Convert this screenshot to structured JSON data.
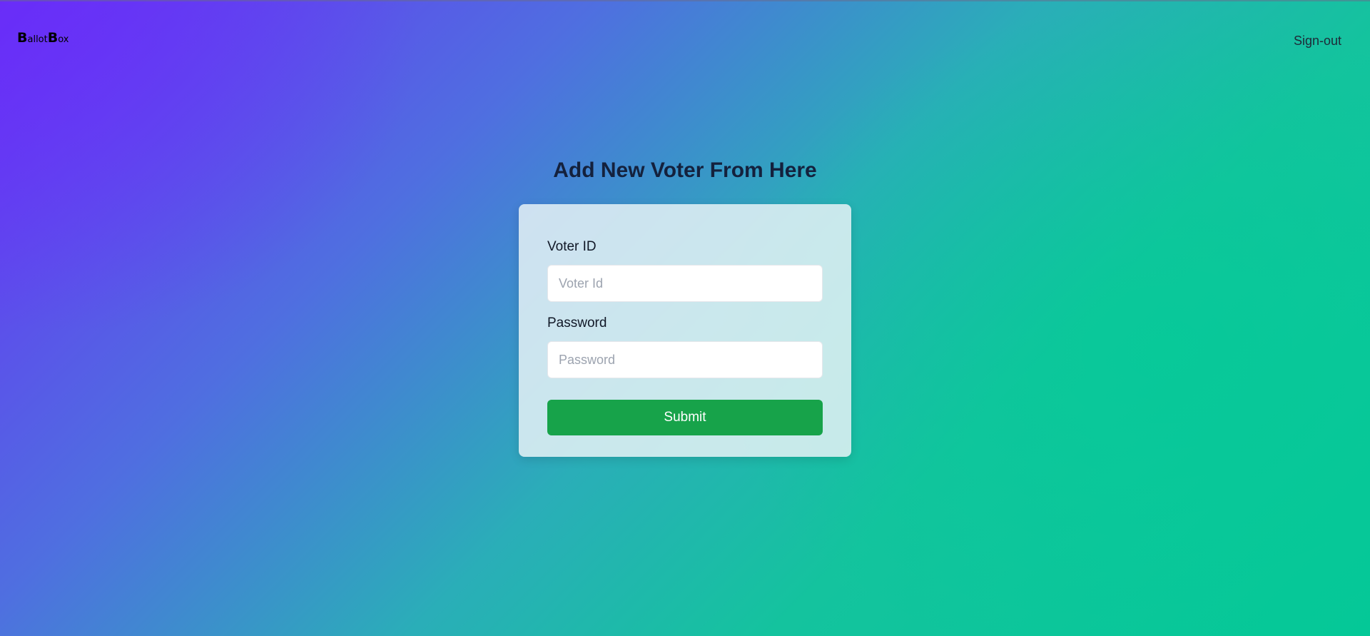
{
  "app": {
    "logo_text": "BallotBox",
    "logo_parts": [
      {
        "text": "B",
        "big": true
      },
      {
        "text": "allot",
        "big": false
      },
      {
        "text": "B",
        "big": true
      },
      {
        "text": "ox",
        "big": false
      }
    ]
  },
  "header": {
    "signout_label": "Sign-out"
  },
  "main": {
    "title": "Add New Voter From Here"
  },
  "form": {
    "voter_id": {
      "label": "Voter ID",
      "placeholder": "Voter Id",
      "value": ""
    },
    "password": {
      "label": "Password",
      "placeholder": "Password",
      "value": ""
    },
    "submit_label": "Submit"
  },
  "colors": {
    "gradient_start": "#6a2cf7",
    "gradient_end": "#04c897",
    "submit_bg": "#17a34a",
    "title_text": "#14213d"
  }
}
